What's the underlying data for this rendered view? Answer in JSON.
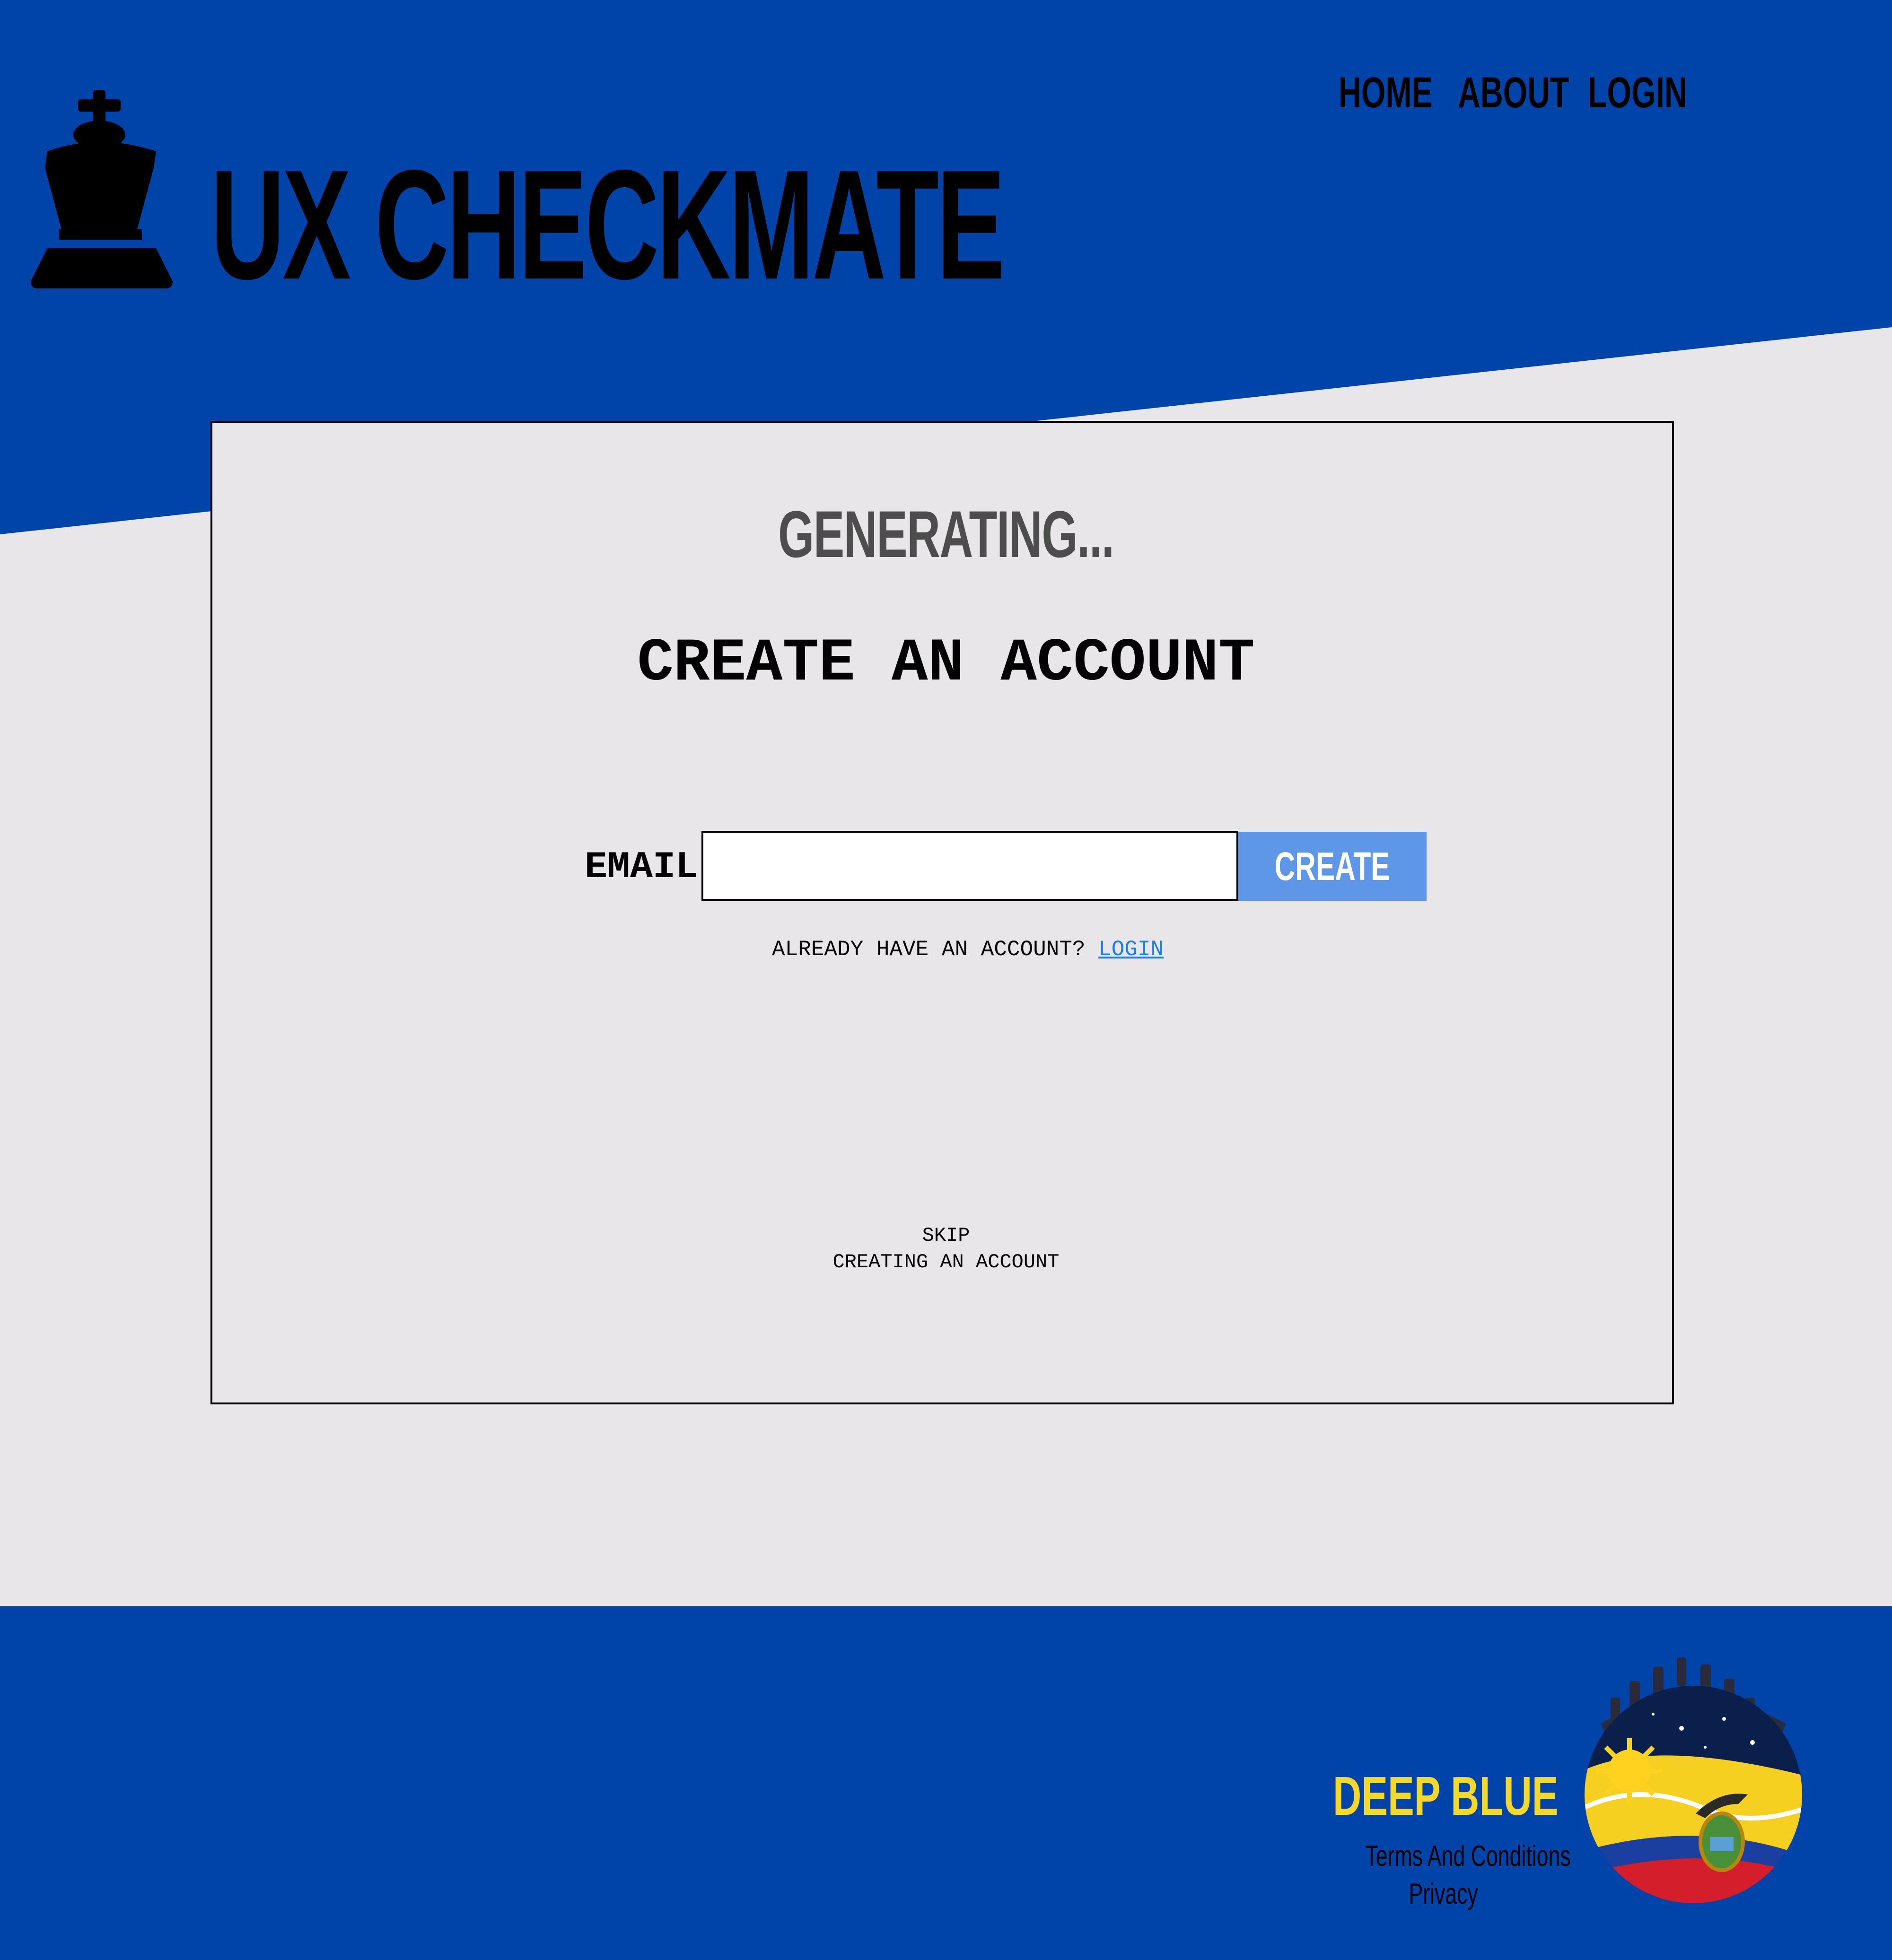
{
  "header": {
    "brand": "UX CHECKMATE",
    "nav": {
      "home": "HOME",
      "about": "ABOUT",
      "login": "LOGIN"
    }
  },
  "card": {
    "status": "GENERATING...",
    "title": "CREATE AN ACCOUNT",
    "email_label": "EMAIL",
    "email_value": "",
    "create_button": "CREATE",
    "already_text": "ALREADY HAVE AN ACCOUNT?",
    "login_link": "LOGIN",
    "skip_line1": "SKIP",
    "skip_line2": "CREATING AN ACCOUNT"
  },
  "footer": {
    "team": "DEEP BLUE",
    "terms": "Terms And Conditions",
    "privacy": "Privacy"
  },
  "colors": {
    "brand_blue": "#0044aa",
    "background": "#e8e6e9",
    "button": "#5f97e8",
    "link": "#1a7fe0",
    "team_yellow": "#f5d829"
  },
  "icons": {
    "logo": "chess-king-icon",
    "team_logo": "chess-crown-flag-emblem"
  }
}
